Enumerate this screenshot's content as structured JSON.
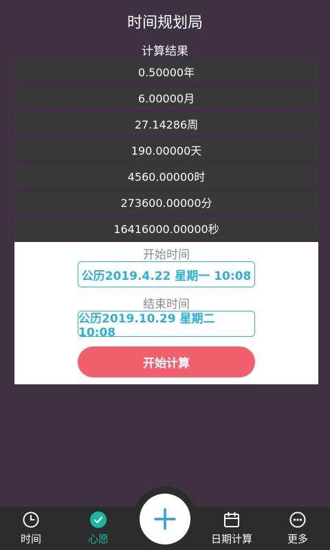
{
  "header": {
    "title": "时间规划局"
  },
  "results": {
    "title": "计算结果",
    "rows": [
      "0.50000年",
      "6.00000月",
      "27.14286周",
      "190.00000天",
      "4560.00000时",
      "273600.00000分",
      "16416000.00000秒"
    ]
  },
  "form": {
    "start_label": "开始时间",
    "start_value": "公历2019.4.22 星期一 10:08",
    "end_label": "结束时间",
    "end_value": "公历2019.10.29 星期二 10:08",
    "submit_label": "开始计算"
  },
  "tabbar": {
    "items": [
      {
        "label": "时间",
        "icon": "clock-icon"
      },
      {
        "label": "心愿",
        "icon": "check-circle-icon",
        "active": true
      },
      {
        "label": "",
        "icon": "plus-icon"
      },
      {
        "label": "日期计算",
        "icon": "calendar-icon"
      },
      {
        "label": "更多",
        "icon": "more-icon"
      }
    ]
  },
  "colors": {
    "background": "#3d3142",
    "accent": "#2bb0d9",
    "button": "#f2606d",
    "active_tab": "#1ab6a0",
    "tabbar": "#2c2c2c"
  }
}
